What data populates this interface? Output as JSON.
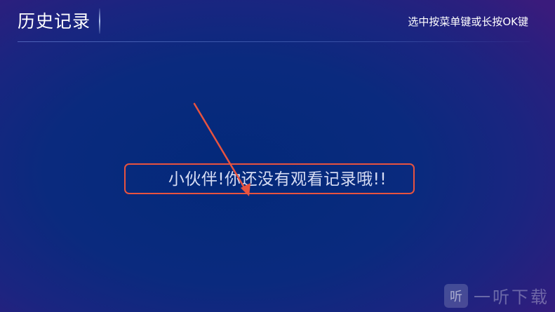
{
  "header": {
    "title": "历史记录",
    "hint": "选中按菜单键或长按OK键"
  },
  "main": {
    "empty_message": "小伙伴!你还没有观看记录哦!!"
  },
  "watermark": {
    "icon_char": "听",
    "text": "一听下载"
  },
  "colors": {
    "background": "#06287a",
    "annotation": "#e8533f"
  }
}
